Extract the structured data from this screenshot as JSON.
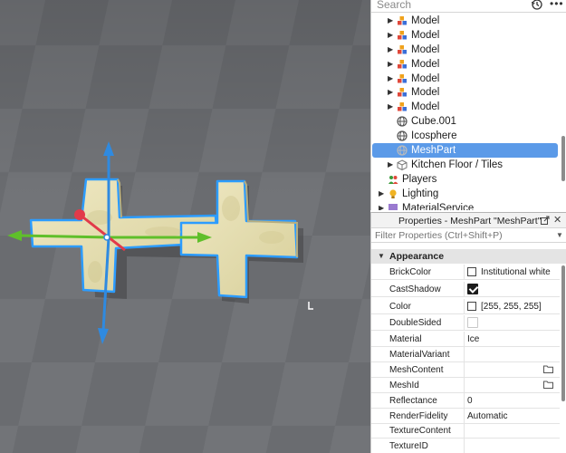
{
  "explorer": {
    "search_placeholder": "Search",
    "items": [
      {
        "label": "Model",
        "icon": "model-icon",
        "expandable": true
      },
      {
        "label": "Model",
        "icon": "model-icon",
        "expandable": true
      },
      {
        "label": "Model",
        "icon": "model-icon",
        "expandable": true
      },
      {
        "label": "Model",
        "icon": "model-icon",
        "expandable": true
      },
      {
        "label": "Model",
        "icon": "model-icon",
        "expandable": true
      },
      {
        "label": "Model",
        "icon": "model-icon",
        "expandable": true
      },
      {
        "label": "Model",
        "icon": "model-icon",
        "expandable": true
      },
      {
        "label": "Cube.001",
        "icon": "mesh-globe-icon",
        "expandable": false
      },
      {
        "label": "Icosphere",
        "icon": "mesh-globe-icon",
        "expandable": false
      },
      {
        "label": "MeshPart",
        "icon": "mesh-globe-icon",
        "expandable": false,
        "selected": true
      },
      {
        "label": "Kitchen Floor / Tiles",
        "icon": "package-cube-icon",
        "expandable": true
      },
      {
        "label": "Players",
        "icon": "players-icon",
        "expandable": false
      },
      {
        "label": "Lighting",
        "icon": "lightbulb-icon",
        "expandable": true
      },
      {
        "label": "MaterialService",
        "icon": "material-icon",
        "expandable": true
      }
    ]
  },
  "properties": {
    "title": "Properties - MeshPart \"MeshPart\"",
    "filter_placeholder": "Filter Properties (Ctrl+Shift+P)",
    "section": "Appearance",
    "rows": {
      "brickcolor": {
        "name": "BrickColor",
        "value": "Institutional white"
      },
      "castshadow": {
        "name": "CastShadow",
        "checked": true
      },
      "color": {
        "name": "Color",
        "value": "[255, 255, 255]"
      },
      "doublesided": {
        "name": "DoubleSided",
        "checked": false
      },
      "material": {
        "name": "Material",
        "value": "Ice"
      },
      "materialvariant": {
        "name": "MaterialVariant",
        "value": ""
      },
      "meshcontent": {
        "name": "MeshContent",
        "value": ""
      },
      "meshid": {
        "name": "MeshId",
        "value": ""
      },
      "reflectance": {
        "name": "Reflectance",
        "value": "0"
      },
      "renderfidelity": {
        "name": "RenderFidelity",
        "value": "Automatic"
      },
      "texturecontent": {
        "name": "TextureContent",
        "value": ""
      },
      "textureid": {
        "name": "TextureID",
        "value": ""
      }
    }
  },
  "viewport": {
    "axis_colors": {
      "x": "#5fbf2a",
      "y": "#2f8ae0",
      "z": "#e23a4a"
    },
    "selection_color": "#2c9cff"
  }
}
